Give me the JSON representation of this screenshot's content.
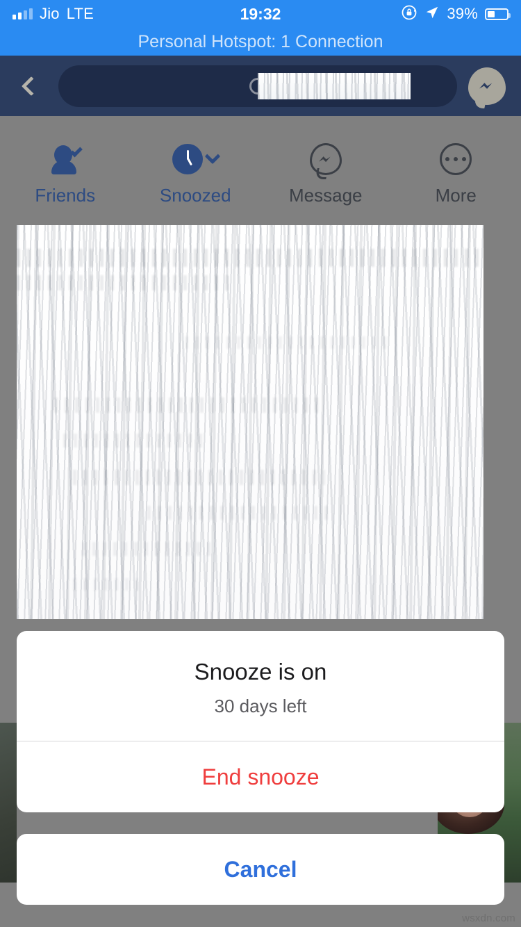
{
  "status_bar": {
    "carrier": "Jio",
    "network": "LTE",
    "time": "19:32",
    "battery_percent": "39%",
    "battery_level": 39,
    "signal_bars_filled": 2,
    "signal_bars_total": 4,
    "icons": [
      "signal-bars-icon",
      "rotation-lock-icon",
      "location-arrow-icon",
      "battery-icon"
    ]
  },
  "hotspot_banner": {
    "text": "Personal Hotspot: 1 Connection",
    "background_color": "#2a8bf2",
    "text_color": "#cfe4fb"
  },
  "nav_bar": {
    "background_color": "#2b3c5e",
    "back_icon": "chevron-left-icon",
    "search": {
      "icon": "search-icon",
      "value": "",
      "placeholder": "",
      "redacted": true
    },
    "messenger_icon": "messenger-icon"
  },
  "profile_actions": [
    {
      "label": "Friends",
      "icon": "person-check-icon",
      "style": "primary"
    },
    {
      "label": "Snoozed",
      "icon": "clock-chevron-icon",
      "style": "primary"
    },
    {
      "label": "Message",
      "icon": "messenger-outline-icon",
      "style": "default"
    },
    {
      "label": "More",
      "icon": "ellipsis-circle-icon",
      "style": "default"
    }
  ],
  "content": {
    "redacted": true,
    "note": ""
  },
  "action_sheet": {
    "title": "Snooze is on",
    "subtitle": "30 days left",
    "destructive_action": "End snooze",
    "cancel_action": "Cancel",
    "destructive_color": "#ef3e3e",
    "cancel_color": "#2f6fdb"
  },
  "watermark": "wsxdn.com",
  "theme": {
    "status_blue": "#2a8bf2",
    "nav_navy": "#2b3c5e",
    "dim_overlay": "#808080",
    "accent_blue": "#2d4b82"
  }
}
